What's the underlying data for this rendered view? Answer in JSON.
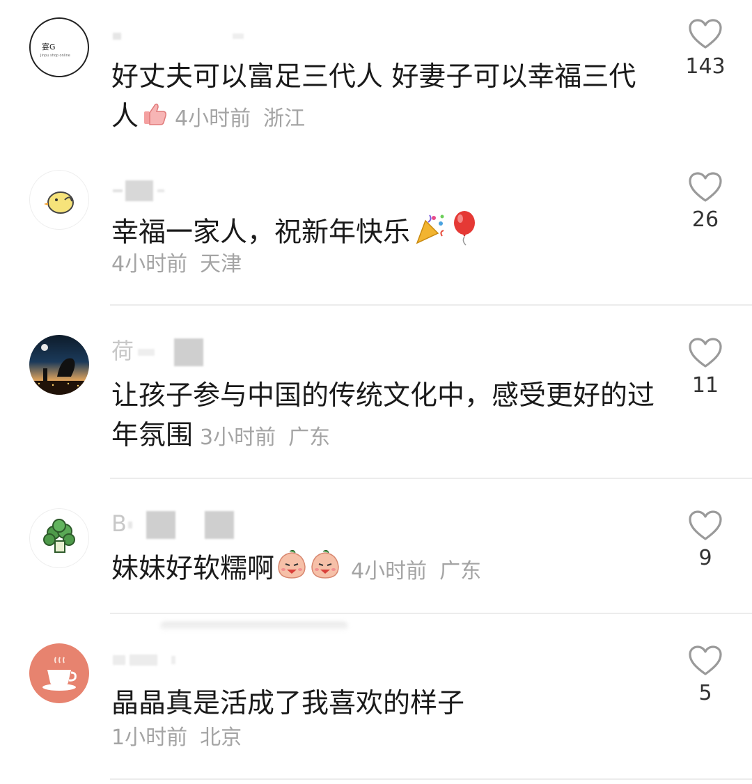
{
  "comments": [
    {
      "username": "",
      "avatar": {
        "icon": "text-logo-avatar",
        "label": "宴G",
        "sublabel": "Jinpu shop online"
      },
      "text": "好丈夫可以富足三代人 好妻子可以幸福三代人",
      "emoji": [
        "thumbs-up"
      ],
      "time": "4小时前",
      "location": "浙江",
      "likes": "143"
    },
    {
      "username": "",
      "avatar": {
        "icon": "chick-avatar"
      },
      "text": "幸福一家人，祝新年快乐",
      "emoji": [
        "party-popper",
        "balloon"
      ],
      "time": "4小时前",
      "location": "天津",
      "likes": "26"
    },
    {
      "username": "荷",
      "avatar": {
        "icon": "night-city-avatar"
      },
      "text": "让孩子参与中国的传统文化中，感受更好的过年氛围",
      "emoji": [],
      "time": "3小时前",
      "location": "广东",
      "likes": "11"
    },
    {
      "username": "B",
      "avatar": {
        "icon": "broccoli-avatar"
      },
      "text": "妹妹好软糯啊",
      "emoji": [
        "peach-face",
        "peach-face"
      ],
      "time": "4小时前",
      "location": "广东",
      "likes": "9"
    },
    {
      "username": "",
      "avatar": {
        "icon": "coffee-cup-avatar"
      },
      "text": "晶晶真是活成了我喜欢的样子",
      "emoji": [],
      "time": "1小时前",
      "location": "北京",
      "likes": "5"
    }
  ],
  "colors": {
    "like_outline": "#9a9a9a",
    "meta": "#a4a4a4",
    "text": "#1a1a1a"
  }
}
